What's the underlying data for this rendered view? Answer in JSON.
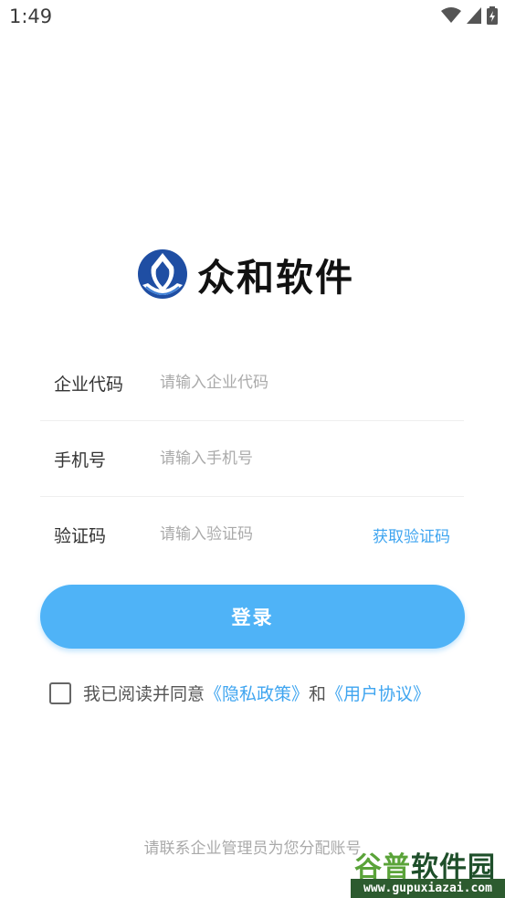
{
  "status_bar": {
    "time": "1:49"
  },
  "app": {
    "name": "众和软件"
  },
  "form": {
    "company": {
      "label": "企业代码",
      "placeholder": "请输入企业代码"
    },
    "phone": {
      "label": "手机号",
      "placeholder": "请输入手机号"
    },
    "code": {
      "label": "验证码",
      "placeholder": "请输入验证码",
      "get_code": "获取验证码"
    }
  },
  "login_button": "登录",
  "agreement": {
    "prefix": "我已阅读并同意",
    "privacy": "《隐私政策》",
    "and": "和",
    "terms": "《用户协议》",
    "checked": false
  },
  "footer": "请联系企业管理员为您分配账号",
  "watermark": {
    "title": "谷普软件园",
    "url": "www.gupuxiazai.com"
  },
  "colors": {
    "accent": "#4fb3f7",
    "link": "#3fa5f0",
    "logo_blue": "#1f4ea3"
  },
  "icons": [
    "wifi-icon",
    "signal-icon",
    "battery-icon",
    "logo-icon",
    "checkbox-icon"
  ]
}
